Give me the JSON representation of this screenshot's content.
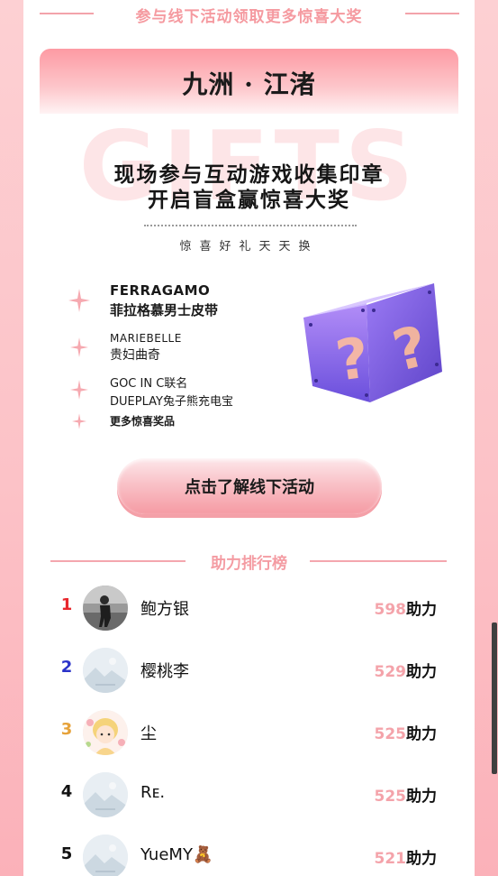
{
  "banner": {
    "text": "参与线下活动领取更多惊喜大奖"
  },
  "venue": {
    "title": "九洲 · 江渚"
  },
  "promo": {
    "watermark": "GIFTS",
    "headline_line1": "现场参与互动游戏收集印章",
    "headline_line2": "开启盲盒赢惊喜大奖",
    "subline": "惊喜好礼天天换"
  },
  "prizes": [
    {
      "line1": "FERRAGAMO",
      "line2": "菲拉格慕男士皮带"
    },
    {
      "line1": "MARIEBELLE",
      "line2": "贵妇曲奇"
    },
    {
      "line1": "GOC IN C联名",
      "line2": "DUEPLAY兔子熊充电宝"
    },
    {
      "line1": "更多惊喜奖品"
    }
  ],
  "cta": {
    "label": "点击了解线下活动"
  },
  "ranking": {
    "title": "助力排行榜",
    "unit": "助力",
    "rows": [
      {
        "rank": "1",
        "name": "鲍方银",
        "score": "598",
        "rank_color": "#e8282d",
        "avatar": "photo-avatar"
      },
      {
        "rank": "2",
        "name": "樱桃李",
        "score": "529",
        "rank_color": "#2b33c9",
        "avatar": "placeholder-avatar"
      },
      {
        "rank": "3",
        "name": "尘",
        "score": "525",
        "rank_color": "#e6a23a",
        "avatar": "girl-avatar"
      },
      {
        "rank": "4",
        "name": "Rᴇ.",
        "score": "525",
        "rank_color": "#111111",
        "avatar": "placeholder-avatar"
      },
      {
        "rank": "5",
        "name": "YueMY🧸",
        "score": "521",
        "rank_color": "#111111",
        "avatar": "placeholder-avatar"
      }
    ]
  },
  "colors": {
    "accent_pink": "#f59aa0",
    "cube_purple": "#8f6ef2",
    "question_mark": "#f3b6a6"
  }
}
